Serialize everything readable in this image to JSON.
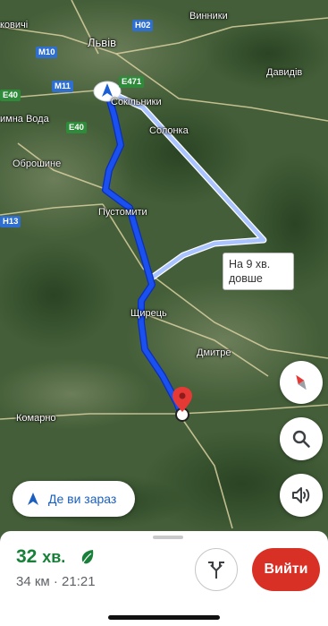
{
  "map": {
    "labels": {
      "lviv": "Львів",
      "sokilnyky": "Сокільники",
      "solonka": "Солонка",
      "obroshyne": "Оброшине",
      "pustomyty": "Пустомити",
      "shchyrets": "Щирець",
      "dmytre": "Дмитре",
      "komarno": "Комарно",
      "vynnyky": "Винники",
      "davydiv": "Давидів",
      "zymna_voda": "имна Вода",
      "kovych": "ковичі"
    },
    "shields": {
      "h02": "H02",
      "m10": "M10",
      "m11": "M11",
      "e471": "E471",
      "e40a": "E40",
      "e40b": "E40",
      "h13": "H13"
    },
    "alt_route_card": "На 9 хв. довше",
    "colors": {
      "route": "#1a4ff0",
      "alt_route": "#a9c4ff",
      "pin": "#e53935"
    }
  },
  "controls": {
    "compass_icon": "compass-icon",
    "search_icon": "search-icon",
    "sound_icon": "sound-icon",
    "where_now_label": "Де ви зараз"
  },
  "sheet": {
    "eta_value": "32",
    "eta_unit": "хв.",
    "eco_icon": "leaf-icon",
    "distance_time": "34 км · 21:21",
    "exit_label": "Вийти",
    "accent": "#188038",
    "exit_color": "#d93025"
  }
}
